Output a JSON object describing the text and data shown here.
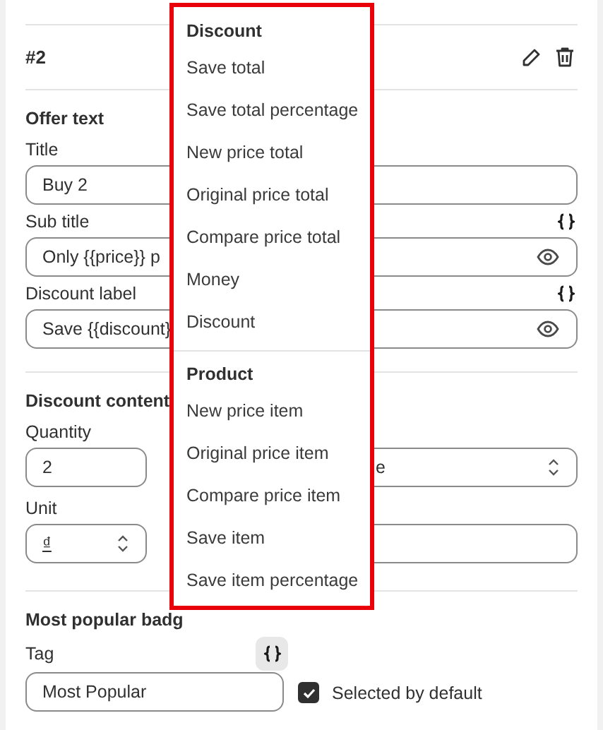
{
  "header": {
    "title": "#2"
  },
  "offer_text": {
    "heading": "Offer text",
    "fields": [
      {
        "label": "Title",
        "value": "Buy 2",
        "variables": false,
        "preview": false
      },
      {
        "label": "Sub title",
        "value": "Only {{price}} p",
        "variables": true,
        "preview": true
      },
      {
        "label": "Discount label",
        "value": "Save {{discount}",
        "variables": true,
        "preview": true
      }
    ]
  },
  "discount_content": {
    "heading": "Discount content",
    "quantity": {
      "label": "Quantity",
      "value": "2"
    },
    "type_select": {
      "value": "e"
    },
    "unit": {
      "label": "Unit",
      "value": "₫"
    }
  },
  "badge": {
    "heading": "Most popular badg",
    "tag": {
      "label": "Tag",
      "value": "Most Popular"
    },
    "selected_by_default": {
      "label": "Selected by default",
      "checked": true
    }
  },
  "variable_menu": {
    "groups": [
      {
        "heading": "Discount",
        "items": [
          "Save total",
          "Save total percentage",
          "New price total",
          "Original price total",
          "Compare price total",
          "Money",
          "Discount"
        ]
      },
      {
        "heading": "Product",
        "items": [
          "New price item",
          "Original price item",
          "Compare price item",
          "Save item",
          "Save item percentage"
        ]
      }
    ]
  }
}
